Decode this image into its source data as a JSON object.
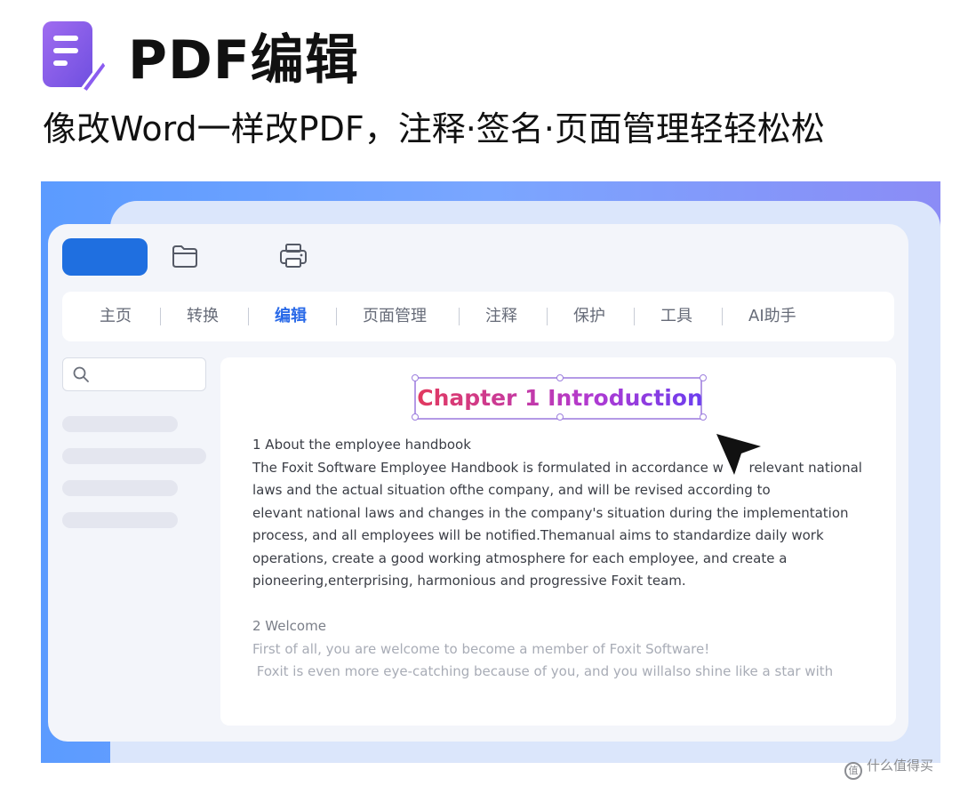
{
  "header": {
    "title": "PDF编辑",
    "subtitle": "像改Word一样改PDF，注释·签名·页面管理轻轻松松"
  },
  "toolbar": {
    "icons": [
      "folder-open-icon",
      "printer-icon"
    ]
  },
  "tabs": [
    {
      "label": "主页",
      "active": false
    },
    {
      "label": "转换",
      "active": false
    },
    {
      "label": "编辑",
      "active": true
    },
    {
      "label": "页面管理",
      "active": false
    },
    {
      "label": "注释",
      "active": false
    },
    {
      "label": "保护",
      "active": false
    },
    {
      "label": "工具",
      "active": false
    },
    {
      "label": "AI助手",
      "active": false
    }
  ],
  "document": {
    "chapter_title": "Chapter 1 Introduction",
    "section1": {
      "heading": "1 About the employee handbook",
      "lines": [
        "The Foxit Software Employee Handbook is formulated in accordance w      relevant national",
        "laws and the actual situation ofthe company, and will be revised according to",
        "elevant national laws and changes in the company's situation during the implementation",
        "process, and all employees will be notified.Themanual aims to standardize daily work",
        "operations, create a good working atmosphere for each employee, and create a",
        "pioneering,enterprising, harmonious and progressive Foxit team."
      ]
    },
    "section2": {
      "heading": "2 Welcome",
      "lines": [
        "First of all, you are welcome to become a member of Foxit Software!",
        " Foxit is even more eye-catching because of you, and you willalso shine like a star with"
      ]
    }
  },
  "colors": {
    "accent": "#1f6fe0",
    "active_tab": "#2a6ae8",
    "title_gradient": [
      "#e23a5e",
      "#6a3ef0"
    ],
    "banner_gradient": [
      "#5b9bff",
      "#8b8cf6"
    ]
  },
  "watermark": {
    "mark": "值",
    "text": "什么值得买"
  }
}
